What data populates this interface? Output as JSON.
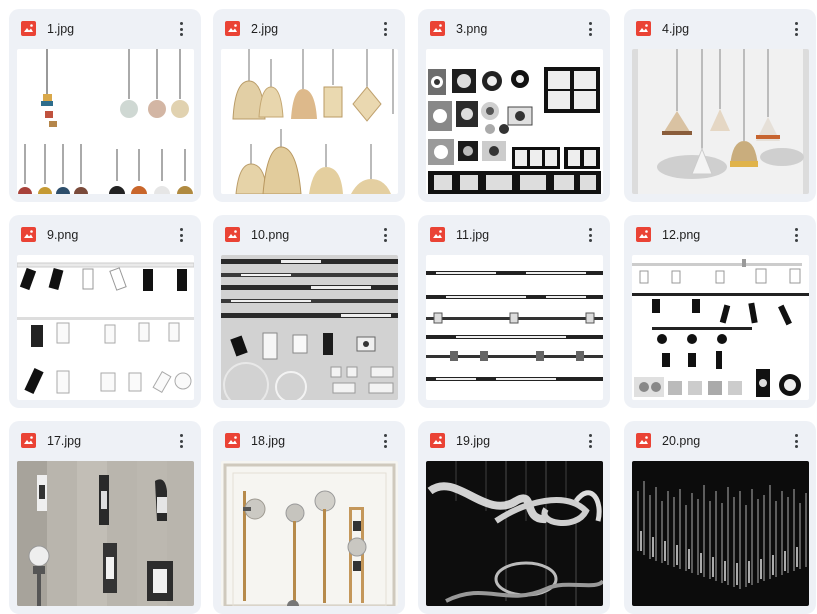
{
  "files": [
    {
      "name": "1.jpg",
      "type": "image",
      "theme": "light"
    },
    {
      "name": "2.jpg",
      "type": "image",
      "theme": "light"
    },
    {
      "name": "3.png",
      "type": "image",
      "theme": "light"
    },
    {
      "name": "4.jpg",
      "type": "image",
      "theme": "light"
    },
    {
      "name": "9.png",
      "type": "image",
      "theme": "light"
    },
    {
      "name": "10.png",
      "type": "image",
      "theme": "grey"
    },
    {
      "name": "11.jpg",
      "type": "image",
      "theme": "light"
    },
    {
      "name": "12.png",
      "type": "image",
      "theme": "light"
    },
    {
      "name": "17.jpg",
      "type": "image",
      "theme": "grey"
    },
    {
      "name": "18.jpg",
      "type": "image",
      "theme": "light"
    },
    {
      "name": "19.jpg",
      "type": "image",
      "theme": "dark"
    },
    {
      "name": "20.png",
      "type": "image",
      "theme": "dark"
    }
  ],
  "colors": {
    "card_bg": "#eef1f6",
    "image_icon": "#ea4335",
    "text": "#1f1f1f"
  }
}
